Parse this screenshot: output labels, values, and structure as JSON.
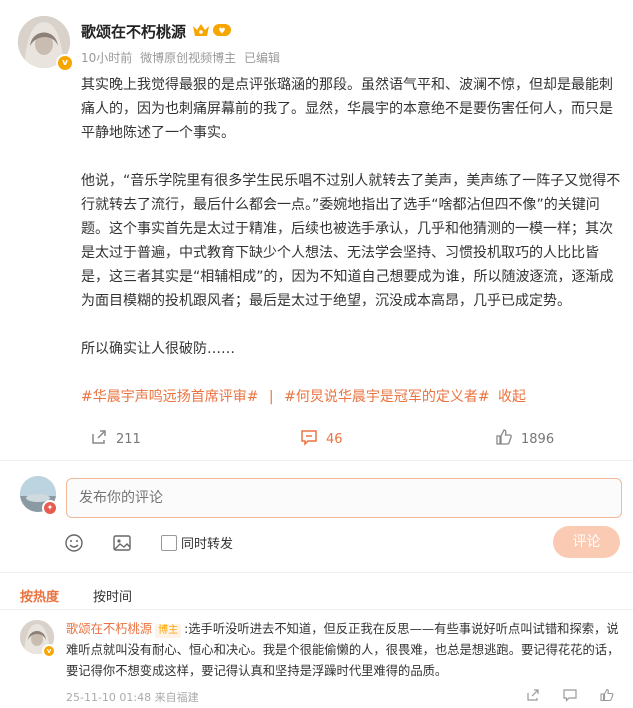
{
  "post": {
    "author": "歌颂在不朽桃源",
    "time": "10小时前",
    "source": "微博原创视频博主",
    "edited": "已编辑",
    "paragraphs": [
      "其实晚上我觉得最狠的是点评张璐涵的那段。虽然语气平和、波澜不惊，但却是最能刺痛人的，因为也刺痛屏幕前的我了。显然，华晨宇的本意绝不是要伤害任何人，而只是平静地陈述了一个事实。",
      "他说，“音乐学院里有很多学生民乐唱不过别人就转去了美声，美声练了一阵子又觉得不行就转去了流行，最后什么都会一点。”委婉地指出了选手“啥都沾但四不像”的关键问题。这个事实首先是太过于精准，后续也被选手承认，几乎和他猜测的一模一样；其次是太过于普遍，中式教育下缺少个人想法、无法学会坚持、习惯投机取巧的人比比皆是，这三者其实是“相辅相成”的，因为不知道自己想要成为谁，所以随波逐流，逐渐成为面目模糊的投机跟风者；最后是太过于绝望，沉没成本高昂，几乎已成定势。",
      "所以确实让人很破防……"
    ],
    "tags": [
      "#华晨宇声鸣远扬首席评审#",
      "|",
      "#何炅说华晨宇是冠军的定义者#",
      "收起"
    ]
  },
  "actions": {
    "repost_count": "211",
    "comment_count": "46",
    "like_count": "1896"
  },
  "composer": {
    "placeholder": "发布你的评论",
    "sync_label": "同时转发",
    "submit_label": "评论"
  },
  "sort": {
    "hot": "按热度",
    "time": "按时间"
  },
  "reply": {
    "author": "歌颂在不朽桃源",
    "tag": "博主",
    "text": ":选手听没听进去不知道，但反正我在反思——有些事说好听点叫试错和探索，说难听点就叫没有耐心、恒心和决心。我是个很能偷懒的人，很畏难，也总是想逃跑。要记得花花的话，要记得你不想变成这样，要记得认真和坚持是浮躁时代里难得的品质。",
    "meta": "25-11-10 01:48 来自福建"
  },
  "colors": {
    "accent": "#eb7340",
    "vip": "#f7a600",
    "button": "#fbcab3"
  }
}
